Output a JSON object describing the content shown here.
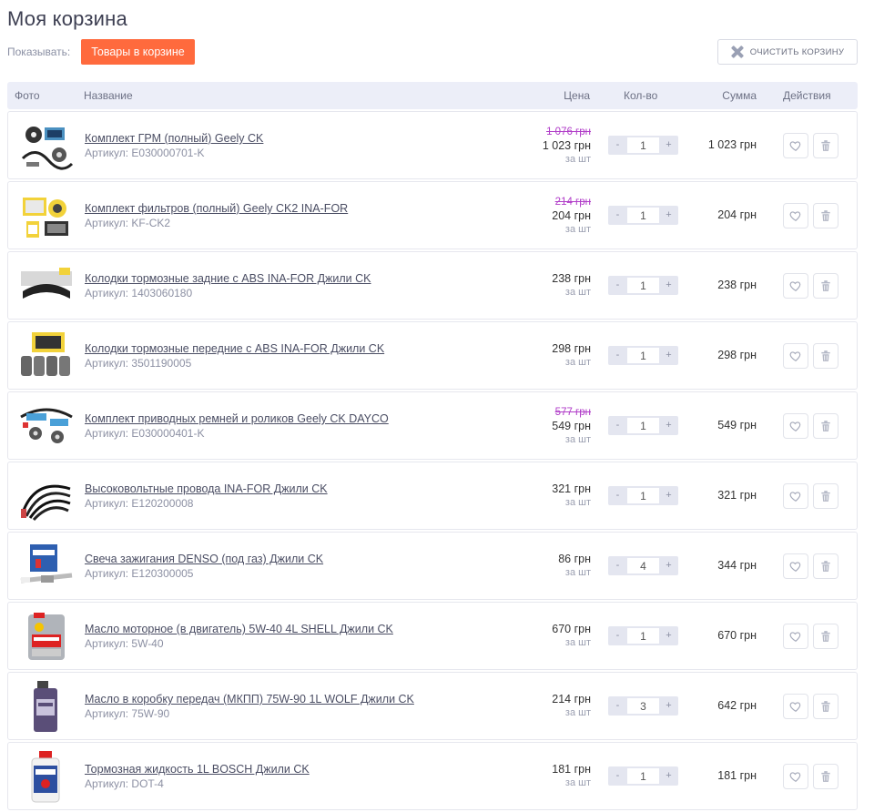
{
  "page": {
    "title": "Моя корзина"
  },
  "filter": {
    "label": "Показывать:",
    "active": "Товары в корзине"
  },
  "toolbar": {
    "clear_label": "ОЧИСТИТЬ КОРЗИНУ"
  },
  "table": {
    "headers": {
      "photo": "Фото",
      "name": "Название",
      "price": "Цена",
      "qty": "Кол-во",
      "sum": "Сумма",
      "actions": "Действия"
    }
  },
  "items": [
    {
      "name": "Комплект ГРМ (полный) Geely CK",
      "sku": "Артикул: E030000701-K",
      "old_price": "1 076 грн",
      "price": "1 023 грн",
      "unit": "за шт",
      "qty": "1",
      "qty_minus": "-",
      "qty_plus": "+",
      "sum": "1 023 грн",
      "photo_icon": "timing-kit-icon"
    },
    {
      "name": "Комплект фильтров (полный) Geely CK2 INA-FOR",
      "sku": "Артикул: KF-CK2",
      "old_price": "214 грн",
      "price": "204 грн",
      "unit": "за шт",
      "qty": "1",
      "qty_minus": "-",
      "qty_plus": "+",
      "sum": "204 грн",
      "photo_icon": "filters-kit-icon"
    },
    {
      "name": "Колодки тормозные задние с ABS INA-FOR Джили CK",
      "sku": "Артикул: 1403060180",
      "old_price": "",
      "price": "238 грн",
      "unit": "за шт",
      "qty": "1",
      "qty_minus": "-",
      "qty_plus": "+",
      "sum": "238 грн",
      "photo_icon": "brake-shoes-icon"
    },
    {
      "name": "Колодки тормозные передние с ABS INA-FOR Джили CK",
      "sku": "Артикул: 3501190005",
      "old_price": "",
      "price": "298 грн",
      "unit": "за шт",
      "qty": "1",
      "qty_minus": "-",
      "qty_plus": "+",
      "sum": "298 грн",
      "photo_icon": "brake-pads-icon"
    },
    {
      "name": "Комплект приводных ремней и роликов Geely CK DAYCO",
      "sku": "Артикул: E030000401-K",
      "old_price": "577 грн",
      "price": "549 грн",
      "unit": "за шт",
      "qty": "1",
      "qty_minus": "-",
      "qty_plus": "+",
      "sum": "549 грн",
      "photo_icon": "belt-kit-icon"
    },
    {
      "name": "Высоковольтные провода INA-FOR Джили CK",
      "sku": "Артикул: E120200008",
      "old_price": "",
      "price": "321 грн",
      "unit": "за шт",
      "qty": "1",
      "qty_minus": "-",
      "qty_plus": "+",
      "sum": "321 грн",
      "photo_icon": "ignition-wires-icon"
    },
    {
      "name": "Свеча зажигания DENSO (под газ) Джили CK",
      "sku": "Артикул: E120300005",
      "old_price": "",
      "price": "86 грн",
      "unit": "за шт",
      "qty": "4",
      "qty_minus": "-",
      "qty_plus": "+",
      "sum": "344 грн",
      "photo_icon": "spark-plug-icon"
    },
    {
      "name": "Масло моторное (в двигатель) 5W-40 4L SHELL Джили CK",
      "sku": "Артикул: 5W-40",
      "old_price": "",
      "price": "670 грн",
      "unit": "за шт",
      "qty": "1",
      "qty_minus": "-",
      "qty_plus": "+",
      "sum": "670 грн",
      "photo_icon": "motor-oil-icon"
    },
    {
      "name": "Масло в коробку передач (МКПП) 75W-90 1L WOLF Джили CK",
      "sku": "Артикул: 75W-90",
      "old_price": "",
      "price": "214 грн",
      "unit": "за шт",
      "qty": "3",
      "qty_minus": "-",
      "qty_plus": "+",
      "sum": "642 грн",
      "photo_icon": "gear-oil-icon"
    },
    {
      "name": "Тормозная жидкость 1L BOSCH Джили CK",
      "sku": "Артикул: DOT-4",
      "old_price": "",
      "price": "181 грн",
      "unit": "за шт",
      "qty": "1",
      "qty_minus": "-",
      "qty_plus": "+",
      "sum": "181 грн",
      "photo_icon": "brake-fluid-icon"
    }
  ],
  "colors": {
    "accent": "#ff6a3d",
    "old_price": "#b03cc8",
    "header_bg": "#eceef8",
    "qty_bg": "#e4e6f0"
  }
}
